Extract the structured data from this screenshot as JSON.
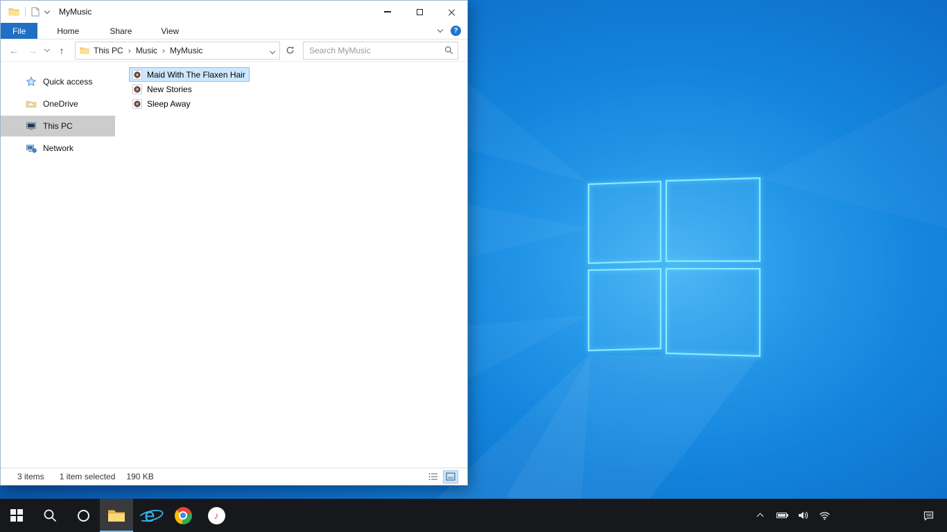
{
  "explorer": {
    "title": "MyMusic",
    "ribbon": {
      "file_tab": "File",
      "tabs": [
        "Home",
        "Share",
        "View"
      ],
      "help": "?"
    },
    "address": {
      "crumbs": [
        "This PC",
        "Music",
        "MyMusic"
      ]
    },
    "search": {
      "placeholder": "Search MyMusic"
    },
    "sidebar": [
      {
        "label": "Quick access",
        "icon": "star-icon"
      },
      {
        "label": "OneDrive",
        "icon": "onedrive-folder-icon"
      },
      {
        "label": "This PC",
        "icon": "computer-icon",
        "selected": true
      },
      {
        "label": "Network",
        "icon": "network-icon"
      }
    ],
    "files": [
      {
        "name": "Maid With The Flaxen Hair",
        "icon": "music-file-icon",
        "selected": true
      },
      {
        "name": "New Stories",
        "icon": "music-file-icon",
        "selected": false
      },
      {
        "name": "Sleep Away",
        "icon": "music-file-icon",
        "selected": false
      }
    ],
    "status": {
      "count": "3 items",
      "selected": "1 item selected",
      "size": "190 KB"
    }
  },
  "glyphs": {
    "back": "←",
    "forward": "→",
    "up": "↑",
    "crumb_sep": "›",
    "note": "♪",
    "ie_letter": "e"
  },
  "taskbar": {
    "items": [
      "start-icon",
      "search-icon",
      "cortana-icon",
      "file-explorer-icon",
      "internet-explorer-icon",
      "chrome-icon",
      "itunes-icon"
    ],
    "tray": [
      "chevron-up-icon",
      "battery-icon",
      "speaker-icon",
      "wifi-icon",
      "action-center-icon"
    ]
  },
  "colors": {
    "accent": "#1f6fc5",
    "selection_bg": "#cce8ff",
    "selection_border": "#8ac2ee",
    "sidebar_selected": "#cccccc",
    "taskbar_bg": "#16181b",
    "wallpaper": "#0d6dc8"
  }
}
